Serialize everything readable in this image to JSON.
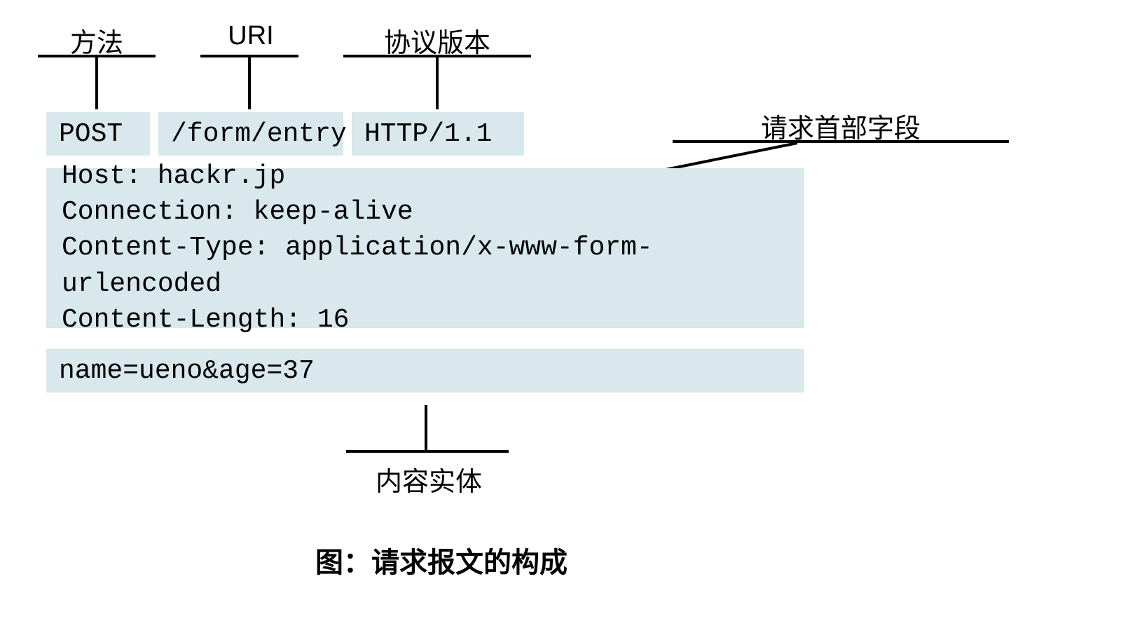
{
  "labels": {
    "method": "方法",
    "uri": "URI",
    "protocol": "协议版本",
    "headers": "请求首部字段",
    "body": "内容实体"
  },
  "requestLine": {
    "method": "POST",
    "uri": "/form/entry",
    "protocol": "HTTP/1.1"
  },
  "headers": {
    "line1": "Host: hackr.jp",
    "line2": "Connection: keep-alive",
    "line3": "Content-Type: application/x-www-form-urlencoded",
    "line4": "Content-Length: 16"
  },
  "body": "name=ueno&age=37",
  "caption": "图：请求报文的构成"
}
